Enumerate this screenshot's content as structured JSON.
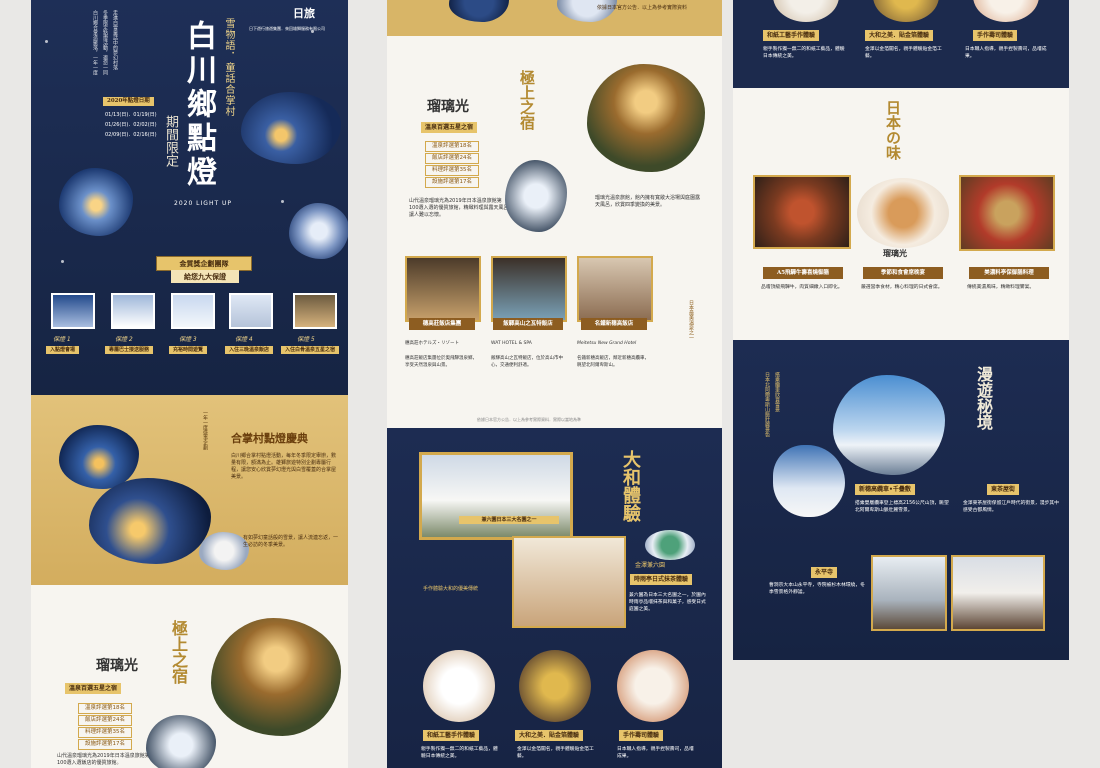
{
  "p1": {
    "logo": "日旅",
    "logo_sub": "日下遊行旅遊集團．來回雄獅服務有限公司",
    "title_top": "雪物語．童話合掌村",
    "title_main": "白川鄉點燈",
    "title_sub": "期間限定",
    "light_up": "2020 LIGHT UP",
    "date_badge": "2020年點燈日期",
    "dates": [
      "01/13(日)．01/19(日)",
      "01/26(日)．02/02(日)",
      "02/09(日)．02/16(日)"
    ],
    "vert_intro": [
      "白川鄉合掌造聚落，一年一度",
      "冬季限定點燈活動，邀您一同",
      "走進白雪童話中的夢幻村落"
    ],
    "award_banner": "金質獎企劃團隊",
    "award_sub": "給您九大保證",
    "guarantees": [
      {
        "label": "保證 1",
        "title": "入點燈會場"
      },
      {
        "label": "保證 2",
        "title": "專屬巴士接送服務"
      },
      {
        "label": "保證 3",
        "title": "充裕時間遊覽"
      },
      {
        "label": "保證 4",
        "title": "入住三晚溫泉飯店"
      },
      {
        "label": "保證 5",
        "title": "入住白骨溫泉五星之宿"
      }
    ],
    "section2_vert": "一年一度盛事企劃",
    "section2_title": "合掌村點燈慶典",
    "section2_body": "白川鄉合掌村點燈活動，每年冬季限定舉辦，數量有限，額滿為止。雄獅旅遊特別企劃專屬行程，讓您安心欣賞夢幻燈光與白雪覆蓋的合掌屋美景。",
    "section2_body2": "有如夢幻童話般的雪景，讓人流連忘返，一生必訪的冬季美景。",
    "hotel_logo": "瑠璃光",
    "hotel_tag": "溫泉百選五星之宿",
    "hotel_heading": "極上之宿",
    "hotel_list": [
      "溫泉評選第18名",
      "飯店評選第24名",
      "料理評選第35名",
      "設施評選第17名"
    ],
    "hotel_body": "山代溫泉瑠璃光為2019年日本溫泉旅館第100選入選飯店的優質旅館。"
  },
  "p2": {
    "gold_caption": "依據日本官方公告．以上為參考實際資料",
    "hotel_logo": "瑠璃光",
    "hotel_tag": "溫泉百選五星之宿",
    "hotel_heading": "極上之宿",
    "hotel_list": [
      "溫泉評選第18名",
      "飯店評選第24名",
      "料理評選第35名",
      "設施評選第17名"
    ],
    "hotel_body": "山代溫泉瑠璃光為2019年日本溫泉旅館第100選入選的優質旅館，精緻料理與露天風呂讓人難以忘懷。",
    "hotel_body2": "瑠璃光溫泉旅館，館內擁有寬敞大浴場與庭園露天風呂，欣賞四季變換的美景。",
    "vert_right": "日本最美溫泉之一",
    "photo_tags": [
      "穗高莊飯店集團",
      "飯驛高山之瓦特飯店",
      "名鐵新穗高飯店"
    ],
    "hotel_brands": [
      "穗高莊ホテルズ・リゾート",
      "WAT HOTEL & SPA",
      "Meitetsu New Grand Hotel"
    ],
    "col_texts": [
      "穗高莊飯店集團位於奧飛驒溫泉鄉，享受天然溫泉與山景。",
      "飯驛高山之瓦特飯店，位於高山市中心，交通便利舒適。",
      "名鐵新穗高飯店，鄰近新穗高纜車，眺望北阿爾卑斯山。"
    ],
    "footer_note": "依據日本官方公告．以上為參考實際資料．實際以當地為準",
    "sec3_heading": "大和體驗",
    "kenrokuen_caption": "兼六園日本三大名園之一",
    "kenrokuen_tag": "金澤兼六園",
    "kenrokuen_title": "時雨亭日式抹茶體驗",
    "kenrokuen_body": "兼六園為日本三大名園之一，於園內時雨亭品嚐抹茶與和菓子，感受日式庭園之美。",
    "vert_tea": "手作體驗大和的優美傳統",
    "crafts": [
      {
        "title": "和紙工藝手作體驗",
        "body": "親手製作獨一無二的和紙工藝品，體驗日本傳統之美。"
      },
      {
        "title": "大和之美．貼金箔體驗",
        "body": "金澤以金箔聞名，親手體驗貼金箔工藝。"
      },
      {
        "title": "手作壽司體驗",
        "body": "日本職人指導，親手捏製壽司，品嚐成果。"
      }
    ]
  },
  "p3": {
    "crafts": [
      {
        "title": "和紙工藝手作體驗",
        "body": "親手製作獨一無二的和紙工藝品，體驗日本傳統之美。"
      },
      {
        "title": "大和之美．貼金箔體驗",
        "body": "金澤以金箔聞名，親手體驗貼金箔工藝。"
      },
      {
        "title": "手作壽司體驗",
        "body": "日本職人指導，親手捏製壽司，品嚐成果。"
      }
    ],
    "taste_heading": "日本の味",
    "dishes": [
      {
        "title": "A5飛驒牛壽喜燒御膳",
        "body": "品嚐頂級飛驒牛，肉質細嫩入口即化。"
      },
      {
        "title": "季節和食會席晚宴",
        "body": "嚴選當季食材，精心料理的日式會席。"
      },
      {
        "title": "美濃料亭保御膳料理",
        "body": "傳統美濃風味，精緻料理饗宴。"
      }
    ],
    "dish_logo": "瑠璃光",
    "trip_heading": "漫遊秘境",
    "vert_left": "日本北阿爾卑斯山脈壯麗景色",
    "vert_left2": "搭乘纜車欣賞雪景",
    "ropeway_tag": "新穗高纜車•千疊敷",
    "ropeway_body": "搭乘雙層纜車登上標高2156公尺山頂，眺望北阿爾卑斯山脈壯麗雪景。",
    "higashi_tag": "東茶屋街",
    "higashi_body": "金澤東茶屋街保留江戶時代的街景，漫步其中感受古都風情。",
    "eiheiji_tag": "永平寺",
    "eiheiji_body": "曹洞宗大本山永平寺，寺院被杉木林環繞，冬季雪景格外靜謐。"
  }
}
